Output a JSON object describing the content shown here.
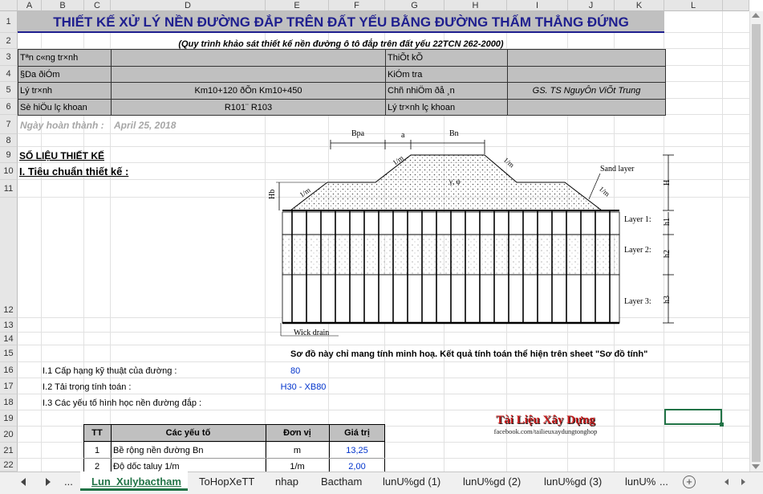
{
  "columns": [
    "A",
    "B",
    "C",
    "D",
    "E",
    "F",
    "G",
    "H",
    "I",
    "J",
    "K",
    "L"
  ],
  "rows": [
    "1",
    "2",
    "3",
    "4",
    "5",
    "6",
    "7",
    "8",
    "9",
    "10",
    "11",
    "12",
    "13",
    "14",
    "15",
    "16",
    "17",
    "18",
    "19",
    "20",
    "21",
    "22"
  ],
  "title": "THIẾT KẾ XỬ LÝ NỀN ĐƯỜNG ĐẮP TRÊN ĐẤT YẾU BẰNG ĐƯỜNG THẤM THẲNG ĐỨNG",
  "subtitle": "(Quy trình khảo sát thiết kế nền đường ô tô đắp trên đất yếu 22TCN 262-2000)",
  "info": {
    "r3_label": "Tên công trình",
    "r3_label_raw": "Tªn c«ng tr×nh",
    "r4_label": "§Da ðiÓm",
    "r5_label": "Lý tr×nh",
    "r5_value": "Km10+120 ðÕn Km10+450",
    "r6_label": "Sè hiÖu lç khoan",
    "r6_value": "R101¨ R103",
    "r3_right": "ThiÕt kÕ",
    "r4_right": "KiÓm tra",
    "r5_right": "Chñ nhiÖm ðå ¸n",
    "r5_right_value": "GS. TS NguyÔn ViÕt Trung",
    "r6_right": "Lý tr×nh lç khoan"
  },
  "date_label": "Ngày hoàn thành :",
  "date_value": "April 25, 2018",
  "so_lieu": "SỐ LIỆU THIẾT KẾ",
  "tieu_chuan": "I. Tiêu chuẩn thiết kế :",
  "diagram": {
    "bpa": "Bpa",
    "a": "a",
    "bn": "Bn",
    "slope1": "1/m",
    "slope2": "1/m",
    "slope3": "1/m",
    "slope4": "1/m",
    "sand_layer": "Sand layer",
    "hb": "Hb",
    "h": "H",
    "h1": "h1",
    "h2": "h2",
    "h3": "h3",
    "layer1": "Layer 1:",
    "layer2": "Layer 2:",
    "layer3": "Layer 3:",
    "wick": "Wick drain",
    "gamma": "γ, φ"
  },
  "note": "Sơ đồ này chỉ mang tính minh hoạ. Kết quả tính toán thể hiện trên sheet \"Sơ đồ tính\"",
  "params": {
    "p1_label": "I.1 Cấp hạng kỹ thuật của đường :",
    "p1_value": "80",
    "p2_label": "I.2 Tải trọng tính toán :",
    "p2_value": "H30 - XB80",
    "p3_label": "I.3 Các yếu tố hình học nền đường đắp :"
  },
  "table": {
    "h_tt": "TT",
    "h_yeuto": "Các yếu tố",
    "h_donvi": "Đơn vị",
    "h_giatri": "Giá trị",
    "rows": [
      {
        "tt": "1",
        "yeuto": "Bề rộng nền đường Bn",
        "donvi": "m",
        "giatri": "13,25"
      },
      {
        "tt": "2",
        "yeuto": "Độ dốc taluy 1/m",
        "donvi": "1/m",
        "giatri": "2,00"
      }
    ]
  },
  "logo": {
    "line1": "Tài Liệu Xây Dựng",
    "line2": "facebook.com/tailieuxaydungtonghop"
  },
  "tabs": [
    "Lun_Xulybactham",
    "ToHopXeTT",
    "nhap",
    "Bactham",
    "lunU%gd (1)",
    "lunU%gd (2)",
    "lunU%gd (3)",
    "lunU%"
  ],
  "tab_controls": {
    "ellipsis": "...",
    "add": "+"
  },
  "colors": {
    "title": "#1f1f8f",
    "header_gray": "#c0c0c0",
    "blue_value": "#0033cc",
    "date_gray": "#a6a6a6",
    "tab_green": "#217346",
    "select_green": "#217346"
  }
}
